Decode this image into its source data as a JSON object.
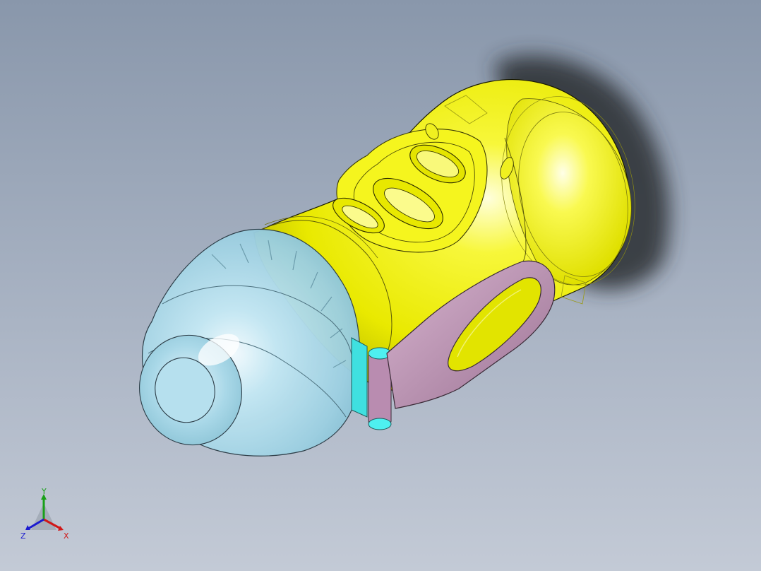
{
  "viewport": {
    "background_top": "#8997ab",
    "background_bottom": "#c3cad6"
  },
  "model": {
    "body_color": "#f2f20a",
    "cap_color": "#aedcec",
    "hinge_color": "#3fe0e0",
    "strap_color": "#b98cb0"
  },
  "triad": {
    "x_label": "X",
    "y_label": "Y",
    "z_label": "Z",
    "x_color": "#d01818",
    "y_color": "#18a018",
    "z_color": "#1a1ad0"
  }
}
